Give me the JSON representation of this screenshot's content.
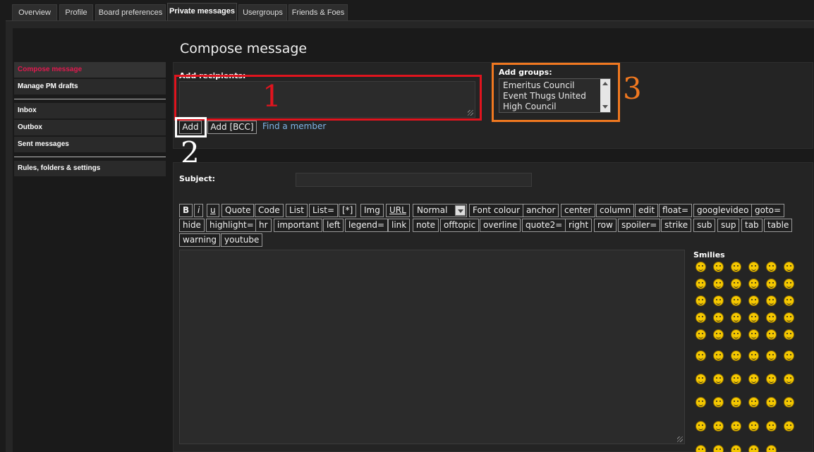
{
  "tabs": [
    {
      "label": "Overview"
    },
    {
      "label": "Profile"
    },
    {
      "label": "Board preferences"
    },
    {
      "label": "Private messages",
      "active": true
    },
    {
      "label": "Usergroups"
    },
    {
      "label": "Friends & Foes"
    }
  ],
  "nav": {
    "items": [
      {
        "label": "Compose message",
        "active": true
      },
      {
        "label": "Manage PM drafts"
      },
      {
        "label": "Inbox"
      },
      {
        "label": "Outbox"
      },
      {
        "label": "Sent messages"
      },
      {
        "label": "Rules, folders & settings"
      }
    ]
  },
  "page": {
    "title": "Compose message"
  },
  "recipients": {
    "label": "Add recipients:",
    "add_label": "Add",
    "add_bcc_label": "Add [BCC]",
    "find_member_label": "Find a member"
  },
  "groups": {
    "label": "Add groups:",
    "options": [
      "Emeritus Council",
      "Event Thugs United",
      "High Council"
    ]
  },
  "annotations": {
    "one": {
      "text": "1",
      "color": "#e0141e"
    },
    "two": {
      "text": "2",
      "color": "#ffffff"
    },
    "three": {
      "text": "3",
      "color": "#f07820"
    }
  },
  "subject": {
    "label": "Subject:",
    "value": ""
  },
  "toolbar": {
    "row1": [
      "B",
      "i",
      "u",
      "Quote",
      "Code",
      "List",
      "List=",
      "[*]",
      "Img",
      "URL"
    ],
    "font_size": "Normal",
    "row1b": [
      "Font colour",
      "anchor",
      "center",
      "column",
      "edit",
      "float=",
      "googlevideo",
      "goto="
    ],
    "row2": [
      "hide",
      "highlight=",
      "hr",
      "important",
      "left",
      "legend=",
      "link",
      "note",
      "offtopic",
      "overline",
      "quote2=",
      "right",
      "row",
      "spoiler=",
      "strike",
      "sub",
      "sup",
      "tab",
      "table"
    ],
    "row3": [
      "warning",
      "youtube"
    ]
  },
  "smilies": {
    "label": "Smilies"
  },
  "colors": {
    "accent_active": "#e01a4f",
    "link": "#7fb4e6"
  }
}
